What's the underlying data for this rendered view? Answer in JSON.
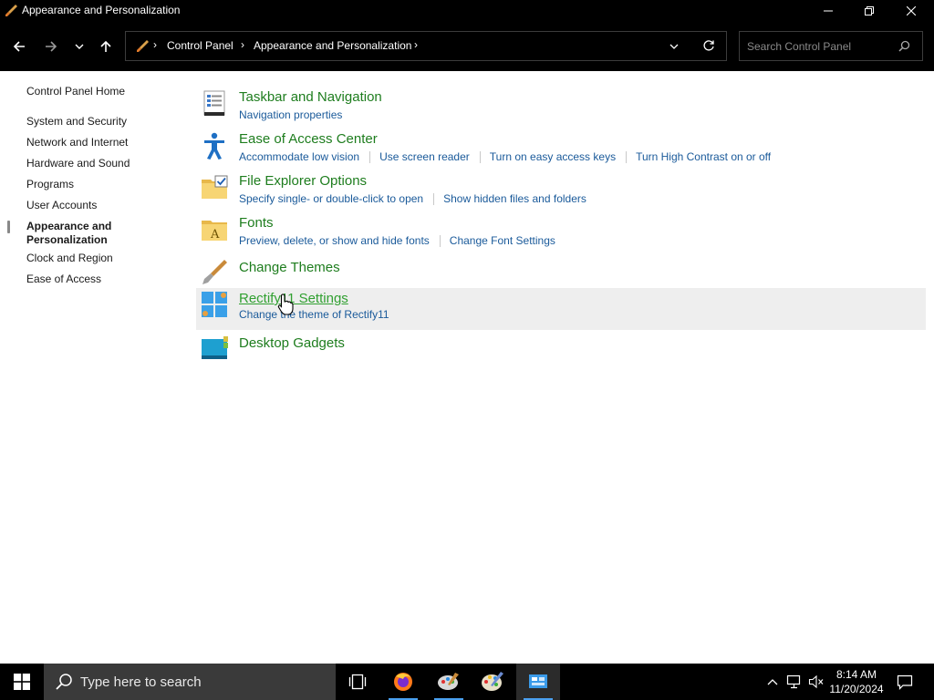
{
  "window": {
    "title": "Appearance and Personalization"
  },
  "address": {
    "crumbs": [
      "Control Panel",
      "Appearance and Personalization"
    ],
    "search_placeholder": "Search Control Panel"
  },
  "sidebar": {
    "home": "Control Panel Home",
    "items": [
      {
        "label": "System and Security"
      },
      {
        "label": "Network and Internet"
      },
      {
        "label": "Hardware and Sound"
      },
      {
        "label": "Programs"
      },
      {
        "label": "User Accounts"
      },
      {
        "label": "Appearance and Personalization",
        "line1": "Appearance and",
        "line2": "Personalization",
        "active": true
      },
      {
        "label": "Clock and Region"
      },
      {
        "label": "Ease of Access"
      }
    ]
  },
  "categories": [
    {
      "heading": "Taskbar and Navigation",
      "icon": "taskbar-icon",
      "links": [
        "Navigation properties"
      ]
    },
    {
      "heading": "Ease of Access Center",
      "icon": "accessibility-icon",
      "links": [
        "Accommodate low vision",
        "Use screen reader",
        "Turn on easy access keys",
        "Turn High Contrast on or off"
      ]
    },
    {
      "heading": "File Explorer Options",
      "icon": "folder-options-icon",
      "links": [
        "Specify single- or double-click to open",
        "Show hidden files and folders"
      ]
    },
    {
      "heading": "Fonts",
      "icon": "fonts-folder-icon",
      "links": [
        "Preview, delete, or show and hide fonts",
        "Change Font Settings"
      ]
    },
    {
      "heading": "Change Themes",
      "icon": "paintbrush-icon",
      "links": []
    },
    {
      "heading": "Rectify11 Settings",
      "icon": "rectify11-icon",
      "links": [
        "Change the theme of Rectify11"
      ],
      "hover": true
    },
    {
      "heading": "Desktop Gadgets",
      "icon": "gadgets-icon",
      "links": []
    }
  ],
  "taskbar": {
    "search_placeholder": "Type here to search",
    "apps": [
      "task-view-icon",
      "firefox-icon",
      "paint-icon",
      "palette-icon",
      "control-panel-icon"
    ],
    "time": "8:14 AM",
    "date": "11/20/2024"
  },
  "colors": {
    "heading_green": "#1e7d1e",
    "link_blue": "#1a5a9a",
    "hover_bg": "#eeeeee"
  }
}
